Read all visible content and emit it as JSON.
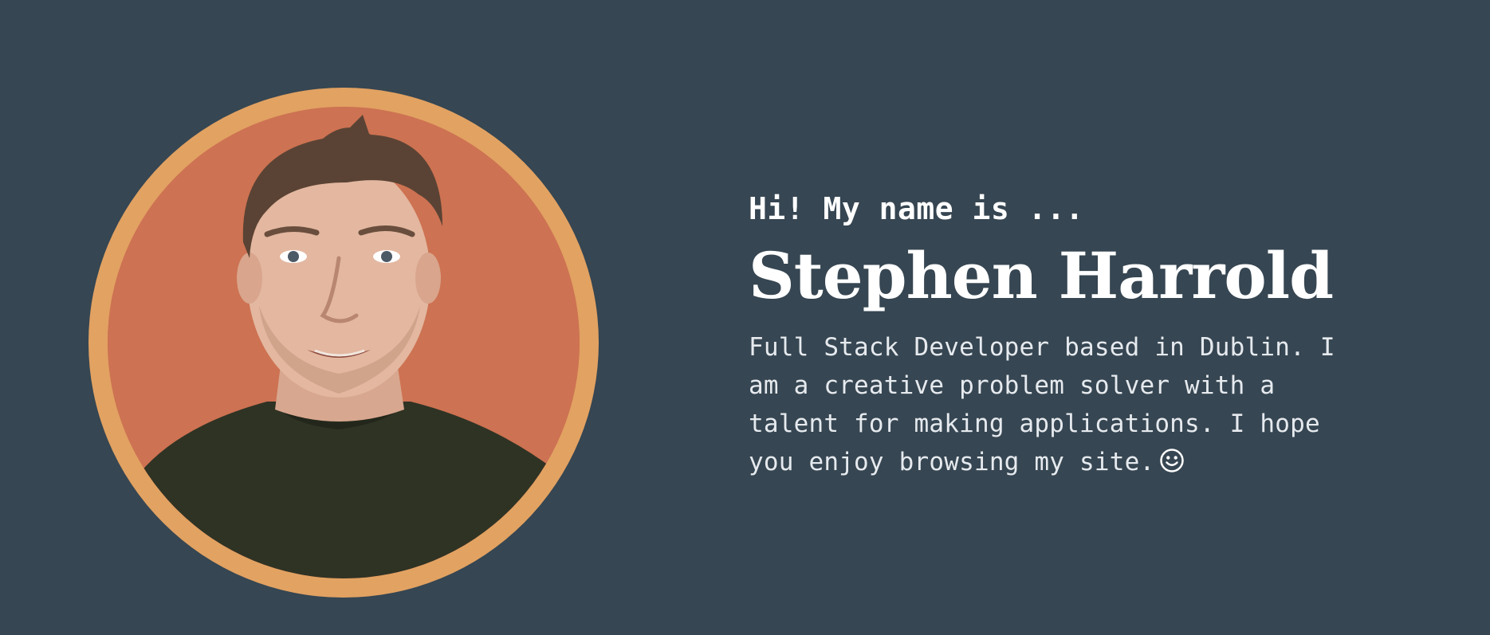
{
  "hero": {
    "greeting": "Hi! My name is ...",
    "name": "Stephen Harrold",
    "bio": "Full Stack Developer based in Dublin. I am a creative problem solver with a talent for making applications. I hope you enjoy browsing my site.",
    "bio_emoji_icon": "smiley-face-icon"
  },
  "colors": {
    "background": "#364652",
    "avatar_ring": "#e2a262",
    "avatar_backdrop": "#cd7252",
    "text_primary": "#ffffff"
  }
}
